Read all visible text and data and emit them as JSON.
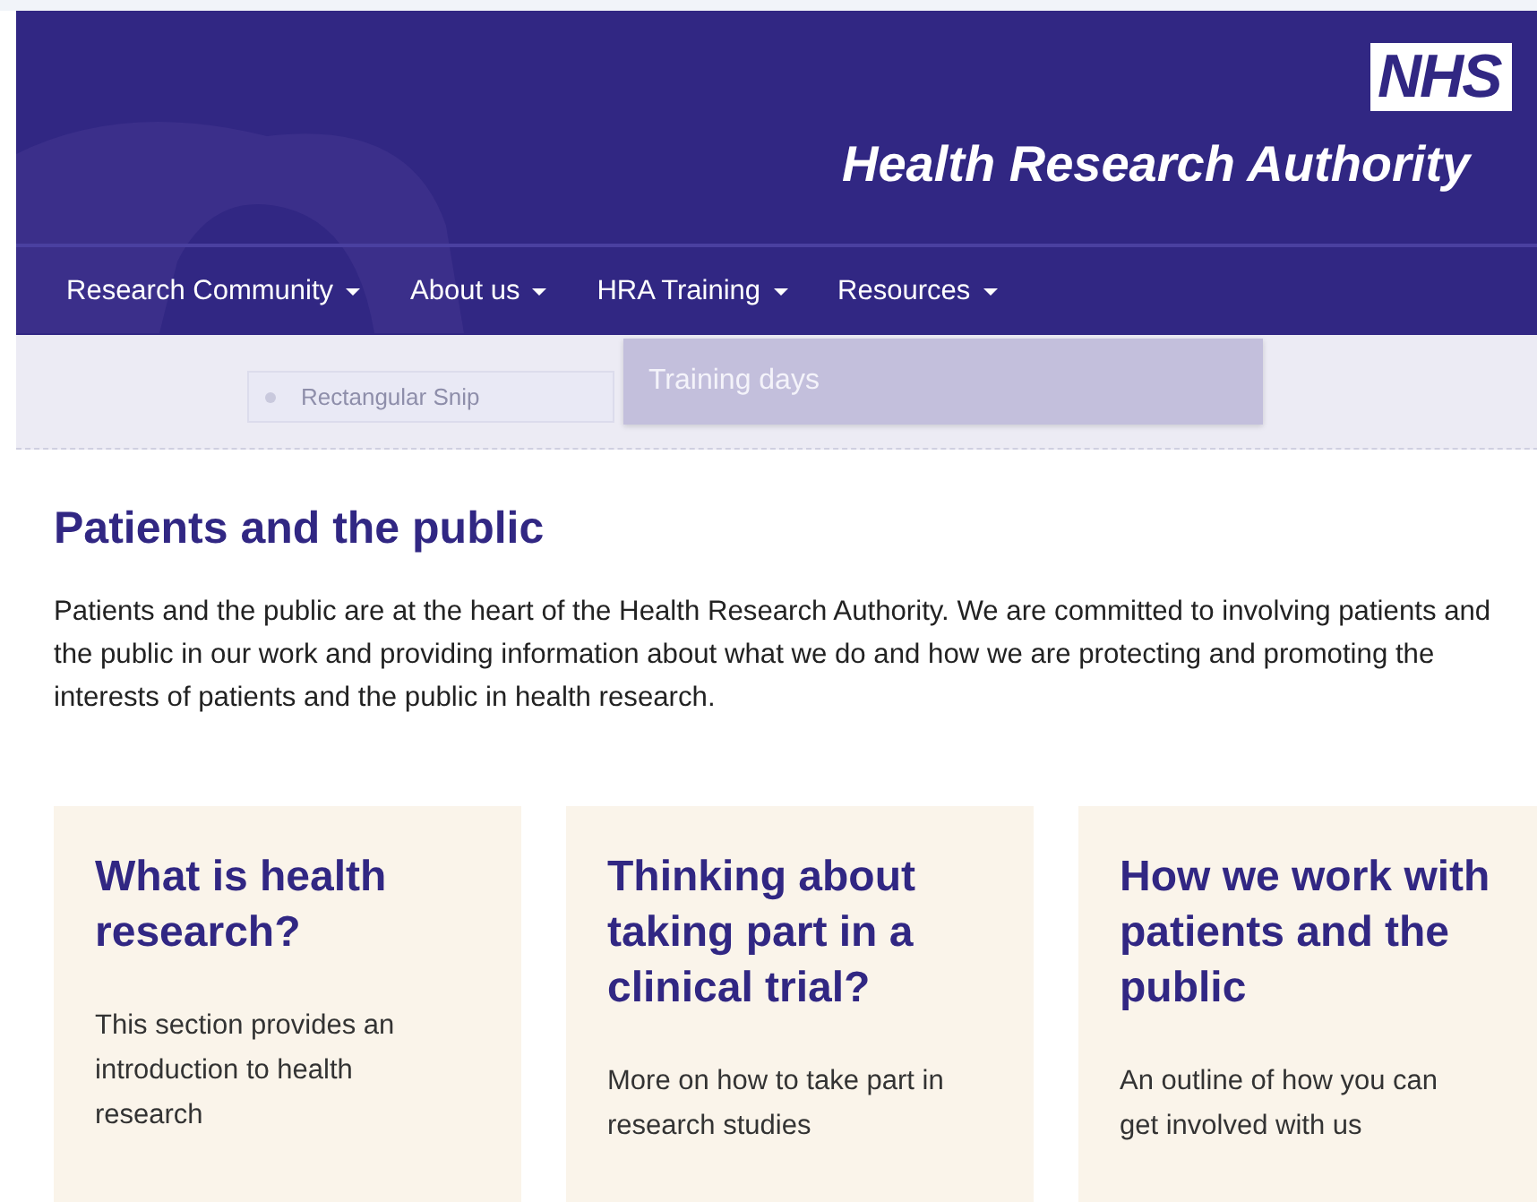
{
  "header": {
    "logo": "NHS",
    "title": "Health Research Authority"
  },
  "nav": {
    "items": [
      {
        "kind": "stub"
      },
      {
        "label": "Research Community"
      },
      {
        "label": "About us"
      },
      {
        "label": "HRA Training"
      },
      {
        "label": "Resources"
      }
    ],
    "dropdown": {
      "items": [
        "Training days"
      ]
    }
  },
  "snip_field": {
    "value": "Rectangular Snip"
  },
  "page": {
    "heading": "Patients and the public",
    "intro": "Patients and the public are at the heart of the Health Research Authority. We are committed to involving patients and the public in our work and providing information about what we do and how we are protecting and promoting the interests of patients and the public in health research."
  },
  "cards": [
    {
      "title": "What is health research?",
      "text": "This section provides an introduction to health research"
    },
    {
      "title": "Thinking about taking part in a clinical trial?",
      "text": "More on how to take part in research studies"
    },
    {
      "title": "How we work with patients and the public",
      "text": "An outline of how you can get involved with us"
    }
  ]
}
